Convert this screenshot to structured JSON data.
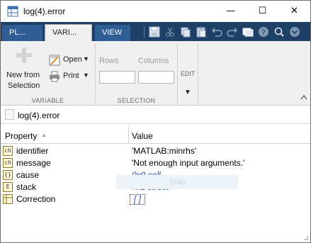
{
  "window": {
    "title": "log(4).error"
  },
  "titlebar_buttons": {
    "minimize": "—",
    "maximize": "☐",
    "close": "✕"
  },
  "tabs": [
    {
      "label": "PL..."
    },
    {
      "label": "VARI..."
    },
    {
      "label": "VIEW"
    }
  ],
  "ribbon": {
    "new_from_selection": {
      "line1": "New from",
      "line2": "Selection"
    },
    "open_label": "Open",
    "print_label": "Print",
    "rows_label": "Rows",
    "columns_label": "Columns",
    "edit_label": "EDIT",
    "groups": {
      "variable": "VARIABLE",
      "selection": "SELECTION"
    }
  },
  "path": "log(4).error",
  "table": {
    "headers": {
      "property": "Property",
      "value": "Value"
    },
    "rows": [
      {
        "icon": "ch",
        "name": "identifier",
        "value": "'MATLAB:minrhs'"
      },
      {
        "icon": "ch",
        "name": "message",
        "value": "'Not enough input arguments.'"
      },
      {
        "icon": "{}",
        "name": "cause",
        "value": "0x0 cell"
      },
      {
        "icon": "E",
        "name": "stack",
        "value": "7x1 struct"
      },
      {
        "icon": "",
        "name": "Correction",
        "value": "[ ]"
      }
    ]
  },
  "overlay": {
    "snip_label": "Snip"
  },
  "colors": {
    "tabstrip": "#1e3f66",
    "tab_inactive": "#2f5e94",
    "link_blue": "#2b58a8"
  }
}
